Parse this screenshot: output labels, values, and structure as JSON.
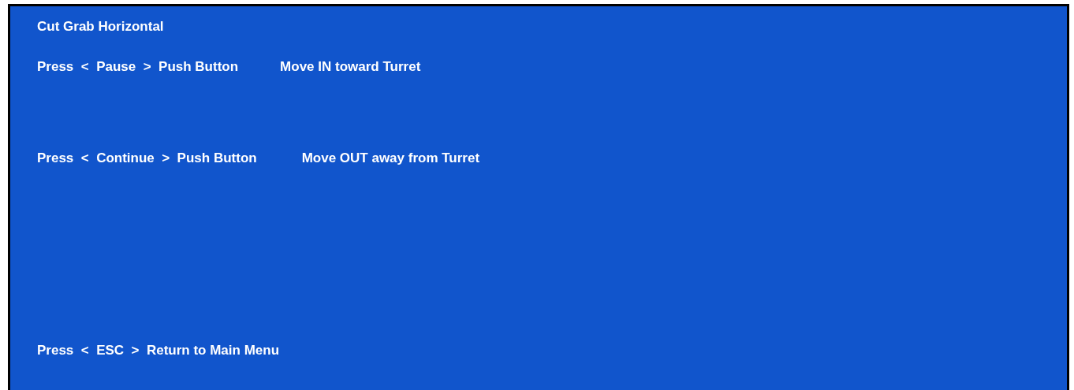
{
  "title": "Cut Grab Horizontal",
  "instructions": [
    {
      "key_text": "Press  <  Pause  >  Push Button",
      "action": "Move IN toward Turret"
    },
    {
      "key_text": "Press  <  Continue  >  Push Button",
      "action": "Move OUT away from Turret"
    },
    {
      "key_text": "Press  <  ESC  >  Return to Main Menu"
    }
  ]
}
